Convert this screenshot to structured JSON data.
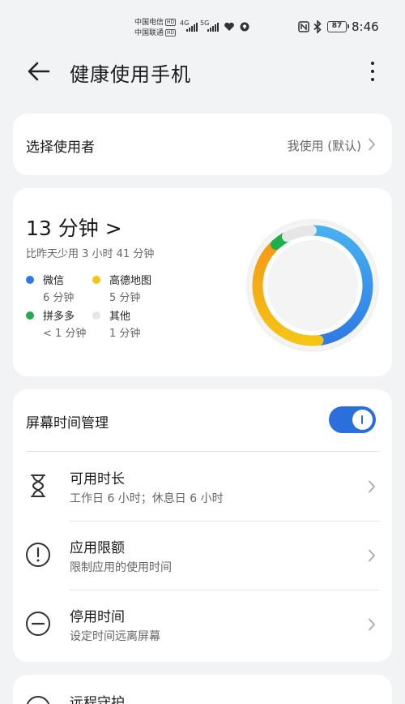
{
  "status_bar": {
    "carrier1": "中国电信",
    "carrier2": "中国联通",
    "hd_badge": "HD",
    "net1": "4G",
    "net2": "5G",
    "battery": "87",
    "time": "8:46"
  },
  "header": {
    "title": "健康使用手机",
    "back_icon": "arrow-left-icon",
    "more_icon": "more-vertical-icon"
  },
  "user_card": {
    "label": "选择使用者",
    "value": "我使用 (默认)"
  },
  "usage": {
    "total": "13 分钟 >",
    "compare": "比昨天少用 3 小时 41 分钟",
    "apps": [
      {
        "name": "微信",
        "time": "6 分钟",
        "color": "#2f7be5"
      },
      {
        "name": "高德地图",
        "time": "5 分钟",
        "color": "#f5c416"
      },
      {
        "name": "拼多多",
        "time": "< 1 分钟",
        "color": "#1fae4b"
      },
      {
        "name": "其他",
        "time": "1 分钟",
        "color": "#e6e6e6"
      }
    ]
  },
  "chart_data": {
    "type": "pie",
    "style": "donut",
    "series": [
      {
        "name": "微信",
        "values": [
          6
        ],
        "color_start": "#46b0f0",
        "color_end": "#2f7be5"
      },
      {
        "name": "高德地图",
        "values": [
          5
        ],
        "color_start": "#f5c416",
        "color_end": "#f59a16"
      },
      {
        "name": "拼多多",
        "values": [
          0.5
        ],
        "color": "#1fae4b"
      },
      {
        "name": "其他",
        "values": [
          1
        ],
        "color": "#e6e6e6"
      }
    ],
    "unit": "分钟"
  },
  "screen_time": {
    "title": "屏幕时间管理",
    "toggle_on": true,
    "rows": [
      {
        "title": "可用时长",
        "subtitle": "工作日 6 小时；休息日 6 小时",
        "icon": "hourglass-icon"
      },
      {
        "title": "应用限额",
        "subtitle": "限制应用的使用时间",
        "icon": "alert-circle-icon"
      },
      {
        "title": "停用时间",
        "subtitle": "设定时间远离屏幕",
        "icon": "minus-circle-icon"
      }
    ]
  },
  "remote": {
    "title": "远程守护"
  },
  "colors": {
    "accent": "#2a6fdb",
    "background": "#f1f3f5",
    "card": "#ffffff"
  }
}
